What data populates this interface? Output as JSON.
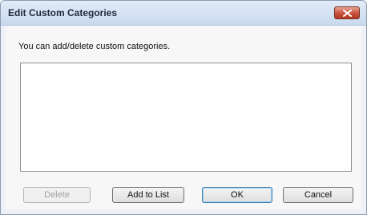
{
  "window": {
    "title": "Edit Custom Categories"
  },
  "titlebar": {
    "close_icon": "close-icon"
  },
  "body": {
    "instruction": "You can add/delete custom categories."
  },
  "category_list": {
    "items": []
  },
  "buttons": {
    "delete": "Delete",
    "add_to_list": "Add to List",
    "ok": "OK",
    "cancel": "Cancel"
  },
  "colors": {
    "title_bar": "#c9d9ee",
    "close_button": "#c7513b",
    "dialog_bg": "#f7f7f7",
    "default_button_border": "#3c7fb1"
  }
}
